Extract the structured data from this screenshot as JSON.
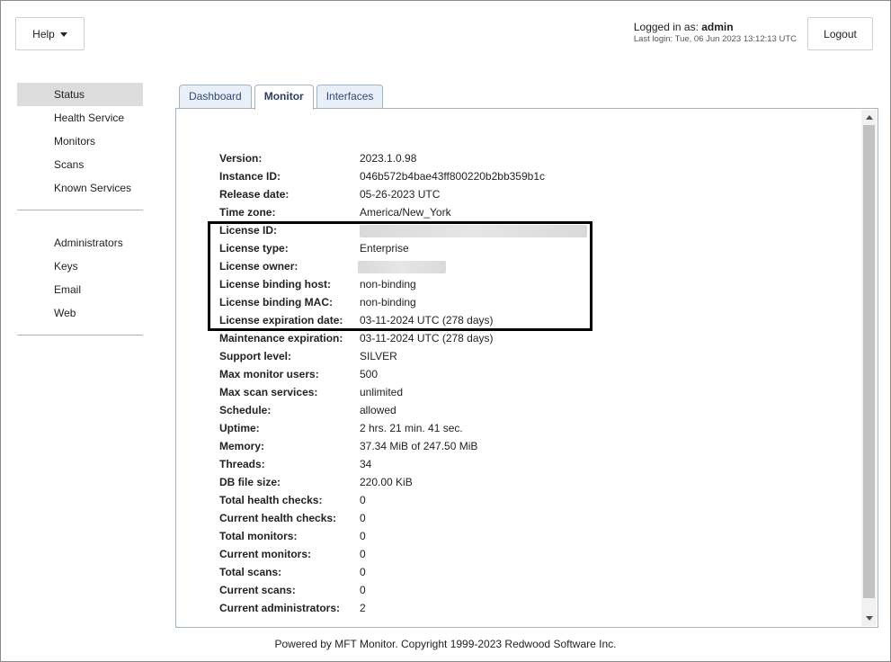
{
  "header": {
    "help_label": "Help",
    "logged_in_prefix": "Logged in as:",
    "username": "admin",
    "last_login": "Last login: Tue, 06 Jun 2023 13:12:13 UTC",
    "logout_label": "Logout"
  },
  "sidebar": {
    "groups": [
      {
        "items": [
          {
            "label": "Status",
            "active": true
          },
          {
            "label": "Health Service"
          },
          {
            "label": "Monitors"
          },
          {
            "label": "Scans"
          },
          {
            "label": "Known Services"
          }
        ]
      },
      {
        "items": [
          {
            "label": "Administrators"
          },
          {
            "label": "Keys"
          },
          {
            "label": "Email"
          },
          {
            "label": "Web"
          }
        ]
      }
    ]
  },
  "tabs": [
    {
      "label": "Dashboard"
    },
    {
      "label": "Monitor",
      "active": true
    },
    {
      "label": "Interfaces"
    }
  ],
  "status": {
    "rows": [
      {
        "key": "Version:",
        "value": "2023.1.0.98"
      },
      {
        "key": "Instance ID:",
        "value": "046b572b4bae43ff800220b2bb359b1c"
      },
      {
        "key": "Release date:",
        "value": "05-26-2023 UTC"
      },
      {
        "key": "Time zone:",
        "value": "America/New_York"
      },
      {
        "key": "License ID:",
        "value": "",
        "redacted": true
      },
      {
        "key": "License type:",
        "value": "Enterprise"
      },
      {
        "key": "License owner:",
        "value": "",
        "redacted": true
      },
      {
        "key": "License binding host:",
        "value": "non-binding"
      },
      {
        "key": "License binding MAC:",
        "value": "non-binding"
      },
      {
        "key": "License expiration date:",
        "value": "03-11-2024 UTC (278 days)"
      },
      {
        "key": "Maintenance expiration:",
        "value": "03-11-2024 UTC (278 days)"
      },
      {
        "key": "Support level:",
        "value": "SILVER"
      },
      {
        "key": "Max monitor users:",
        "value": "500"
      },
      {
        "key": "Max scan services:",
        "value": "unlimited"
      },
      {
        "key": "Schedule:",
        "value": "allowed"
      },
      {
        "key": "Uptime:",
        "value": "2 hrs. 21 min. 41 sec."
      },
      {
        "key": "Memory:",
        "value": "37.34 MiB of 247.50 MiB"
      },
      {
        "key": "Threads:",
        "value": "34"
      },
      {
        "key": "DB file size:",
        "value": "220.00 KiB"
      },
      {
        "key": "Total health checks:",
        "value": "0"
      },
      {
        "key": "Current health checks:",
        "value": "0"
      },
      {
        "key": "Total monitors:",
        "value": "0"
      },
      {
        "key": "Current monitors:",
        "value": "0"
      },
      {
        "key": "Total scans:",
        "value": "0"
      },
      {
        "key": "Current scans:",
        "value": "0"
      },
      {
        "key": "Current administrators:",
        "value": "2"
      }
    ]
  },
  "footer": {
    "text": "Powered by MFT Monitor. Copyright 1999-2023 Redwood Software Inc."
  },
  "colors": {
    "tab_text": "#2c4a80",
    "tab_bg": "#e9eff6",
    "border": "#9fb4c8",
    "active_nav_bg": "#dcdcdc"
  }
}
